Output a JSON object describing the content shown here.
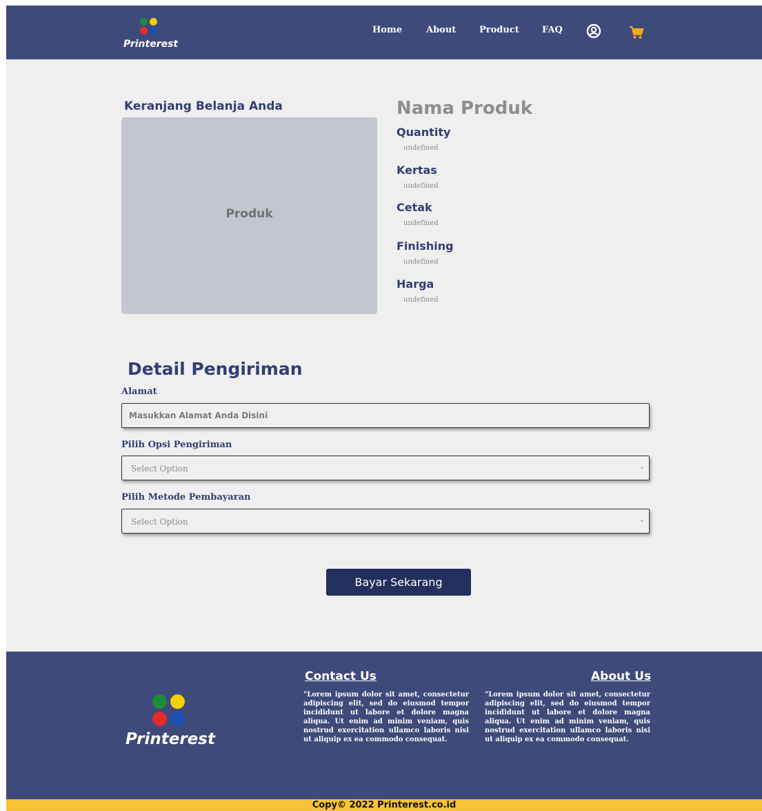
{
  "header": {
    "brand": "Printerest",
    "nav": [
      "Home",
      "About",
      "Product",
      "FAQ"
    ]
  },
  "cart": {
    "title": "Keranjang Belanja Anda",
    "image_label": "Produk",
    "product_name": "Nama Produk",
    "specs": [
      {
        "label": "Quantity",
        "value": "undefined"
      },
      {
        "label": "Kertas",
        "value": "undefined"
      },
      {
        "label": "Cetak",
        "value": "undefined"
      },
      {
        "label": "Finishing",
        "value": "undefined"
      },
      {
        "label": "Harga",
        "value": "undefined"
      }
    ]
  },
  "shipping": {
    "title": "Detail Pengiriman",
    "address_label": "Alamat",
    "address_placeholder": "Masukkan Alamat Anda Disini",
    "shipping_option_label": "Pilih Opsi Pengiriman",
    "shipping_option_value": "Select Option",
    "payment_label": "Pilih Metode Pembayaran",
    "payment_value": "Select Option",
    "pay_button": "Bayar Sekarang"
  },
  "footer": {
    "brand": "Printerest",
    "contact_title": "Contact Us",
    "contact_text": "\"Lorem ipsum dolor sit amet, consectetur adipiscing elit, sed do eiusmod tempor incididunt ut labore et dolore magna aliqua. Ut enim ad minim veniam, quis nostrud exercitation ullamco laboris nisi ut aliquip ex ea commodo consequat.",
    "about_title": "About Us",
    "about_text": "\"Lorem ipsum dolor sit amet, consectetur adipiscing elit, sed do eiusmod tempor incididunt ut labore et dolore magna aliqua. Ut enim ad minim veniam, quis nostrud exercitation ullamco laboris nisi ut aliquip ex ea commodo consequat.",
    "copyright": "Copy© 2022 Printerest.co.id"
  },
  "colors": {
    "header_bg": "#3d4a7a",
    "accent_navy": "#323e74",
    "button_bg": "#232f5c",
    "copyright_bar": "#f5c236",
    "cart_icon": "#f5a623"
  },
  "icons": {
    "account": "user-circle-icon",
    "cart": "shopping-cart-icon"
  }
}
